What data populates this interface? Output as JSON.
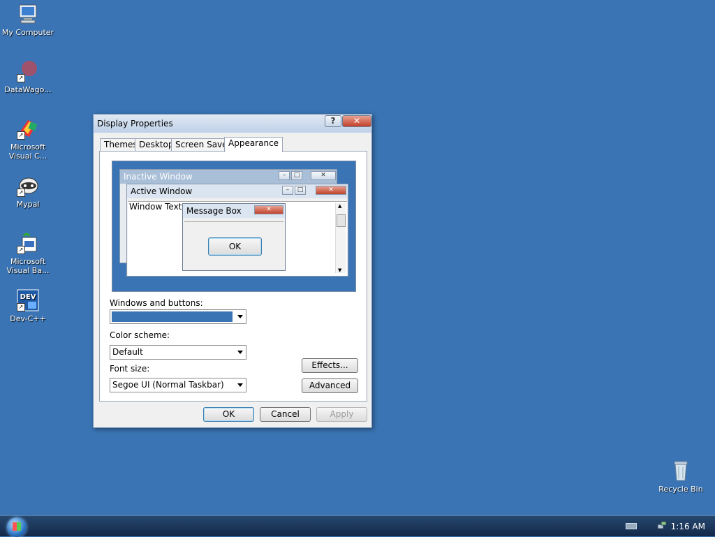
{
  "desktop": {
    "icons": [
      {
        "label": "My Computer"
      },
      {
        "label": "DataWago..."
      },
      {
        "label": "Microsoft Visual C..."
      },
      {
        "label": "Mypal"
      },
      {
        "label": "Microsoft Visual Ba..."
      },
      {
        "label": "Dev-C++"
      },
      {
        "label": "Recycle Bin"
      }
    ]
  },
  "dialog": {
    "title": "Display Properties",
    "help_glyph": "?",
    "close_glyph": "✕",
    "tabs": [
      {
        "label": "Themes"
      },
      {
        "label": "Desktop"
      },
      {
        "label": "Screen Saver"
      },
      {
        "label": "Appearance",
        "active": true
      }
    ],
    "preview": {
      "inactive_title": "Inactive Window",
      "active_title": "Active Window",
      "window_text": "Window Text",
      "message_box_title": "Message Box",
      "ok_label": "OK"
    },
    "windows_buttons_label": "Windows and buttons:",
    "windows_buttons_value": "",
    "color_scheme_label": "Color scheme:",
    "color_scheme_value": "Default",
    "font_size_label": "Font size:",
    "font_size_value": "Segoe UI (Normal Taskbar)",
    "effects_label": "Effects...",
    "advanced_label": "Advanced",
    "ok_label": "OK",
    "cancel_label": "Cancel",
    "apply_label": "Apply"
  },
  "taskbar": {
    "clock": "1:16 AM"
  },
  "colors": {
    "desktop": "#3a74b4",
    "selection": "#3a74b4",
    "close_red": "#c2402a"
  }
}
